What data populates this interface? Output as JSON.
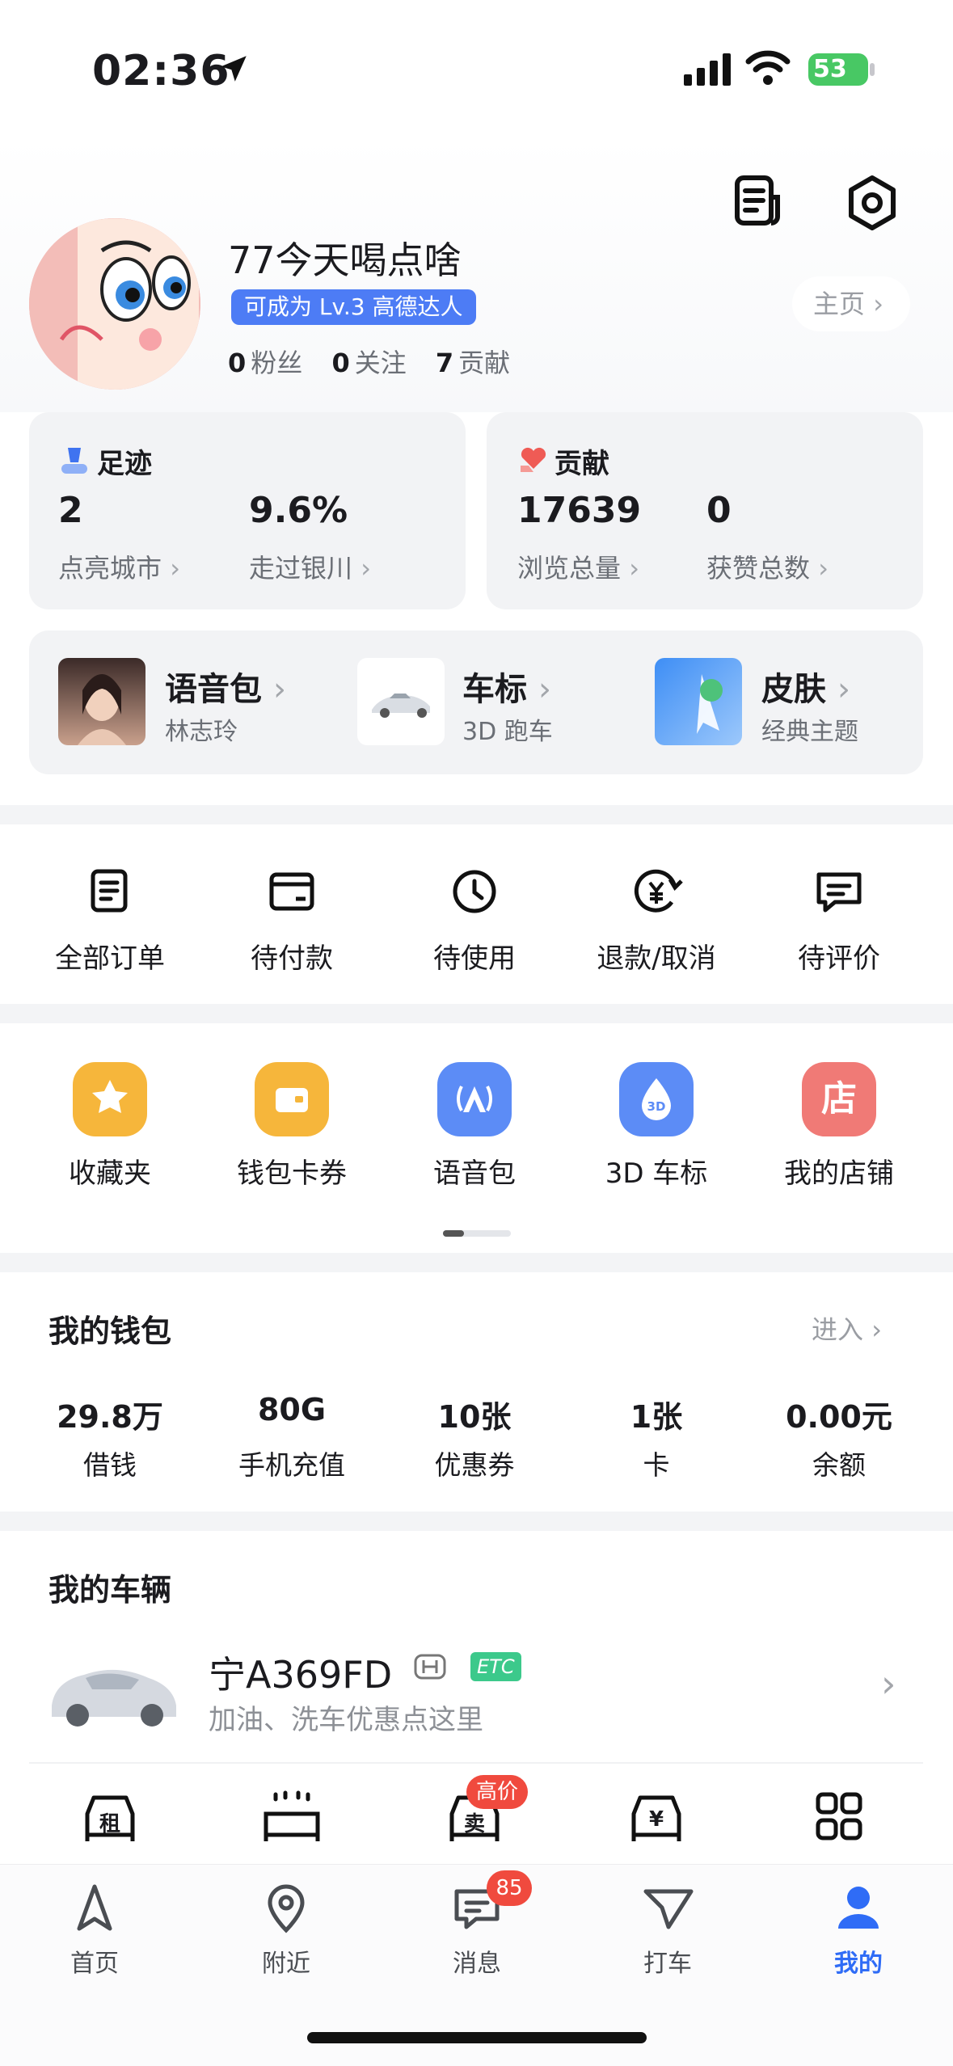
{
  "status_bar": {
    "time": "02:36",
    "battery": "53"
  },
  "profile": {
    "username": "77今天喝点啥",
    "level_badge": "可成为 Lv.3 高德达人",
    "fans_count": "0",
    "fans_label": "粉丝",
    "follow_count": "0",
    "follow_label": "关注",
    "contrib_count": "7",
    "contrib_label": "贡献",
    "home_button": "主页"
  },
  "footprint": {
    "title": "足迹",
    "cities_value": "2",
    "cities_label": "点亮城市",
    "explored_value": "9.6%",
    "explored_label": "走过银川"
  },
  "contribution": {
    "title": "贡献",
    "views_value": "17639",
    "views_label": "浏览总量",
    "likes_value": "0",
    "likes_label": "获赞总数"
  },
  "features": [
    {
      "title": "语音包",
      "subtitle": "林志玲"
    },
    {
      "title": "车标",
      "subtitle": "3D 跑车"
    },
    {
      "title": "皮肤",
      "subtitle": "经典主题"
    }
  ],
  "orders": [
    {
      "label": "全部订单",
      "icon": "list-doc-icon"
    },
    {
      "label": "待付款",
      "icon": "wallet-card-icon"
    },
    {
      "label": "待使用",
      "icon": "clock-icon"
    },
    {
      "label": "退款/取消",
      "icon": "yuan-refund-icon"
    },
    {
      "label": "待评价",
      "icon": "comment-icon"
    }
  ],
  "tools": [
    {
      "label": "收藏夹",
      "icon": "star-icon",
      "color": "#f6b63b"
    },
    {
      "label": "钱包卡券",
      "icon": "wallet-icon",
      "color": "#f6b63b"
    },
    {
      "label": "语音包",
      "icon": "voice-icon",
      "color": "#5c8cf6"
    },
    {
      "label": "3D 车标",
      "icon": "3d-drop-icon",
      "color": "#5c8cf6"
    },
    {
      "label": "我的店铺",
      "icon": "shop-icon",
      "color": "#f07a76",
      "glyph": "店"
    }
  ],
  "wallet": {
    "title": "我的钱包",
    "enter": "进入",
    "items": [
      {
        "value": "29.8万",
        "label": "借钱"
      },
      {
        "value": "80G",
        "label": "手机充值"
      },
      {
        "value": "10张",
        "label": "优惠券"
      },
      {
        "value": "1张",
        "label": "卡"
      },
      {
        "value": "0.00元",
        "label": "余额"
      }
    ]
  },
  "vehicle": {
    "title": "我的车辆",
    "plate": "宁A369FD",
    "etc": "ETC",
    "promo": "加油、洗车优惠点这里",
    "services": [
      {
        "icon": "rent-car-icon",
        "glyph": "租"
      },
      {
        "icon": "car-wash-icon"
      },
      {
        "icon": "sell-car-icon",
        "glyph": "卖",
        "badge": "高价"
      },
      {
        "icon": "car-finance-icon",
        "glyph": "¥"
      },
      {
        "icon": "grid-more-icon"
      }
    ]
  },
  "tabs": [
    {
      "label": "首页"
    },
    {
      "label": "附近"
    },
    {
      "label": "消息",
      "badge": "85"
    },
    {
      "label": "打车"
    },
    {
      "label": "我的"
    }
  ],
  "colors": {
    "accent": "#2f6cf6",
    "badge_red": "#f04a3e",
    "etc_green": "#3cc98b"
  }
}
